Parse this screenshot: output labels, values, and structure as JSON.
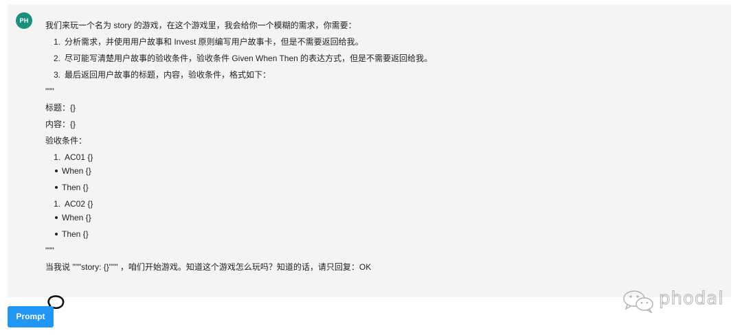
{
  "message": {
    "avatar_initials": "PH",
    "intro": "我们来玩一个名为 story 的游戏，在这个游戏里，我会给你一个模糊的需求，你需要：",
    "steps": [
      {
        "num": "1.",
        "text": "分析需求，并使用用户故事和 Invest 原则编写用户故事卡，但是不需要返回给我。"
      },
      {
        "num": "2.",
        "text": "尽可能写清楚用户故事的验收条件，验收条件 Given When Then 的表达方式，但是不需要返回给我。"
      },
      {
        "num": "3.",
        "text": "最后返回用户故事的标题，内容，验收条件，格式如下："
      }
    ],
    "quote_open": "\"\"\"",
    "title_line": "标题：{}",
    "content_line": "内容：{}",
    "ac_label": "验收条件：",
    "ac1": {
      "num": "1.",
      "text": "AC01 {}",
      "when": "When {}",
      "then": "Then {}"
    },
    "ac2": {
      "num": "1.",
      "text": "AC02 {}",
      "when": "When {}",
      "then": "Then {}"
    },
    "quote_close": "\"\"\"",
    "closing": "当我说 \"\"\"story: {}\"\"\" ，咱们开始游戏。知道这个游戏怎么玩吗？知道的话，请只回复：OK"
  },
  "prompt_button": {
    "label": "Prompt"
  },
  "watermark": {
    "text": "phodal"
  },
  "colors": {
    "accent": "#2196f3",
    "avatar": "#1a8f7d",
    "panel": "#f4f4f4"
  }
}
